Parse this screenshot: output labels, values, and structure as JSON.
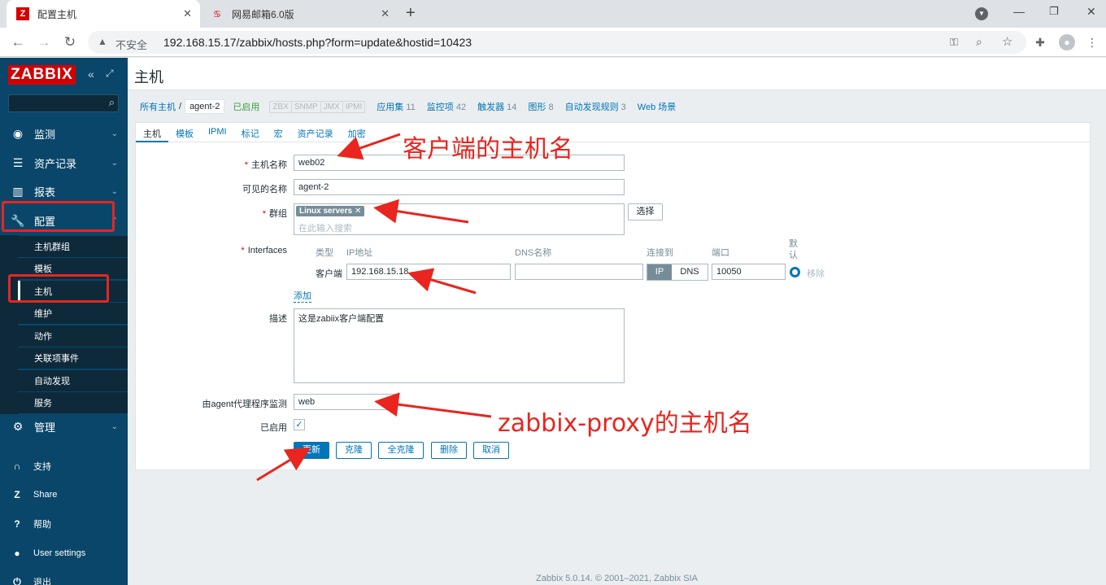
{
  "browser": {
    "tabs": [
      {
        "title": "配置主机",
        "icon": "Z"
      },
      {
        "title": "网易邮箱6.0版",
        "icon": "网"
      }
    ],
    "security_label": "不安全",
    "url": "192.168.15.17/zabbix/hosts.php?form=update&hostid=10423"
  },
  "sidebar": {
    "logo": "ZABBIX",
    "menu": [
      {
        "label": "监测",
        "icon": "eye-icon"
      },
      {
        "label": "资产记录",
        "icon": "list-icon"
      },
      {
        "label": "报表",
        "icon": "chart-icon"
      },
      {
        "label": "配置",
        "icon": "wrench-icon"
      }
    ],
    "config_sub": [
      "主机群组",
      "模板",
      "主机",
      "维护",
      "动作",
      "关联项事件",
      "自动发现",
      "服务"
    ],
    "admin": "管理",
    "bottom": [
      {
        "label": "支持",
        "icon": "headset-icon"
      },
      {
        "label": "Share",
        "icon": "zabbix-share-icon"
      },
      {
        "label": "帮助",
        "icon": "help-icon"
      },
      {
        "label": "User settings",
        "icon": "user-icon"
      },
      {
        "label": "退出",
        "icon": "power-icon"
      }
    ]
  },
  "page": {
    "title": "主机",
    "breadcrumb": {
      "all_hosts": "所有主机",
      "host": "agent-2",
      "status": "已启用",
      "availability": [
        "ZBX",
        "SNMP",
        "JMX",
        "IPMI"
      ],
      "links": [
        {
          "label": "应用集",
          "count": "11"
        },
        {
          "label": "监控项",
          "count": "42"
        },
        {
          "label": "触发器",
          "count": "14"
        },
        {
          "label": "图形",
          "count": "8"
        },
        {
          "label": "自动发现规则",
          "count": "3"
        },
        {
          "label": "Web 场景",
          "count": ""
        }
      ]
    },
    "form_tabs": [
      "主机",
      "模板",
      "IPMI",
      "标记",
      "宏",
      "资产记录",
      "加密"
    ],
    "fields": {
      "hostname_label": "主机名称",
      "hostname": "web02",
      "visible_label": "可见的名称",
      "visible": "agent-2",
      "groups_label": "群组",
      "group_chip": "Linux servers",
      "group_placeholder": "在此输入搜索",
      "select_button": "选择",
      "interfaces_label": "Interfaces",
      "iface_headers": {
        "type": "类型",
        "ip": "IP地址",
        "dns": "DNS名称",
        "connect": "连接到",
        "port": "端口",
        "default": "默认"
      },
      "iface_type": "客户端",
      "iface_ip": "192.168.15.18",
      "iface_dns": "",
      "connect_ip": "IP",
      "connect_dns": "DNS",
      "iface_port": "10050",
      "remove_link": "移除",
      "add_link": "添加",
      "desc_label": "描述",
      "description": "这是zabiix客户端配置",
      "proxy_label": "由agent代理程序监测",
      "proxy_value": "web",
      "enabled_label": "已启用"
    },
    "buttons": {
      "update": "更新",
      "clone": "克隆",
      "full_clone": "全克隆",
      "delete": "删除",
      "cancel": "取消"
    },
    "footer": "Zabbix 5.0.14. © 2001–2021, Zabbix SIA"
  },
  "annotations": {
    "hostname_note": "客户端的主机名",
    "proxy_note": "zabbix-proxy的主机名"
  },
  "colors": {
    "accent": "#0275b8",
    "sidebar": "#0a466a",
    "annotation": "#e8251e",
    "enabled_green": "#429e47"
  }
}
